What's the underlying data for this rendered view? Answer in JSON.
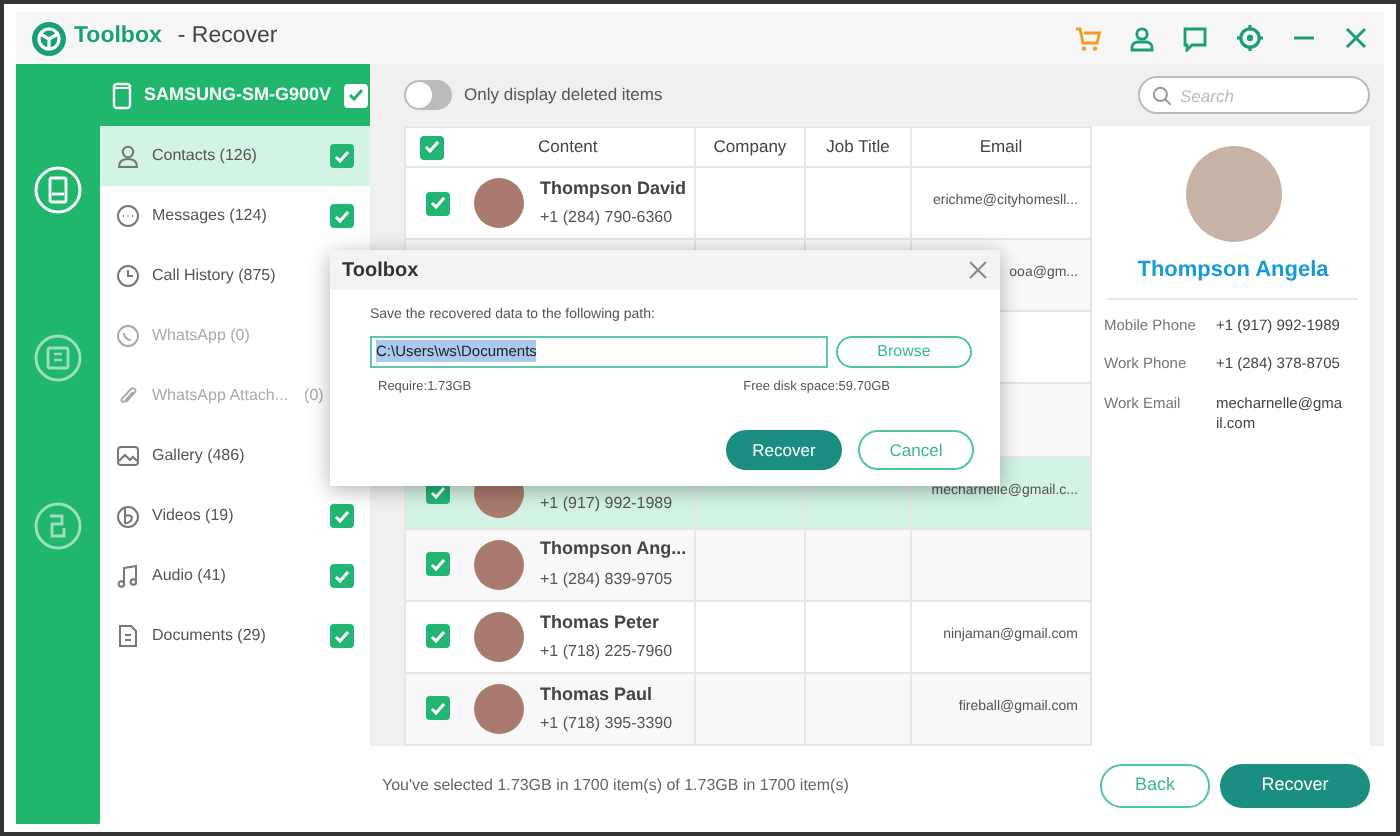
{
  "window": {
    "app_name": "Toolbox",
    "title": "- Recover"
  },
  "rail": [
    {
      "selected": true
    },
    {
      "selected": false
    },
    {
      "selected": false
    }
  ],
  "device": {
    "name": "SAMSUNG-SM-G900V",
    "checked": true
  },
  "sidebar": {
    "items": [
      {
        "label": "Contacts (126)",
        "selected": true,
        "disabled": false,
        "checked": true
      },
      {
        "label": "Messages (124)",
        "selected": false,
        "disabled": false,
        "checked": true
      },
      {
        "label": "Call History (875)",
        "selected": false,
        "disabled": false
      },
      {
        "label": "WhatsApp (0)",
        "selected": false,
        "disabled": true
      },
      {
        "label": "WhatsApp Attach...",
        "count": "(0)",
        "selected": false,
        "disabled": true
      },
      {
        "label": "Gallery (486)",
        "selected": false,
        "disabled": false
      },
      {
        "label": "Videos (19)",
        "selected": false,
        "disabled": false,
        "checked": true
      },
      {
        "label": "Audio (41)",
        "selected": false,
        "disabled": false,
        "checked": true
      },
      {
        "label": "Documents (29)",
        "selected": false,
        "disabled": false,
        "checked": true
      }
    ]
  },
  "filter": {
    "label": "Only display deleted items",
    "on": false
  },
  "search": {
    "placeholder": "Search"
  },
  "table": {
    "header_checked": true,
    "columns": [
      "Content",
      "Company",
      "Job Title",
      "Email"
    ],
    "rows": [
      {
        "checked": true,
        "selected": false,
        "name": "Thompson David",
        "phone": "+1 (284) 790-6360",
        "email": "erichme@cityhomesll..."
      },
      {
        "selected": false,
        "email": "ooa@gm..."
      },
      {
        "selected": false
      },
      {
        "selected": false
      },
      {
        "checked": true,
        "selected": true,
        "phone": "+1 (917) 992-1989",
        "email": "mecharnelle@gmail.c..."
      },
      {
        "checked": true,
        "selected": false,
        "name": "Thompson Ang...",
        "phone": "+1 (284) 839-9705"
      },
      {
        "checked": true,
        "selected": false,
        "name": "Thomas Peter",
        "phone": "+1 (718) 225-7960",
        "email": "ninjaman@gmail.com"
      },
      {
        "checked": true,
        "selected": false,
        "name": "Thomas Paul",
        "phone": "+1 (718) 395-3390",
        "email": "fireball@gmail.com"
      }
    ]
  },
  "details": {
    "name": "Thompson Angela",
    "fields": [
      {
        "label": "Mobile Phone",
        "value": "+1 (917) 992-1989"
      },
      {
        "label": "Work Phone",
        "value": "+1 (284) 378-8705"
      },
      {
        "label": "Work Email",
        "value": "mecharnelle@gmail.com"
      }
    ]
  },
  "footer": {
    "summary": "You've selected 1.73GB in 1700 item(s) of 1.73GB in 1700 item(s)",
    "buttons": [
      "Back",
      "Recover"
    ]
  },
  "dialog": {
    "title": "Toolbox",
    "prompt": "Save the recovered data to the following path:",
    "path": "C:\\Users\\ws\\Documents",
    "browse": "Browse",
    "require": "Require:1.73GB",
    "free": "Free disk space:59.70GB",
    "buttons": [
      "Recover",
      "Cancel"
    ]
  }
}
